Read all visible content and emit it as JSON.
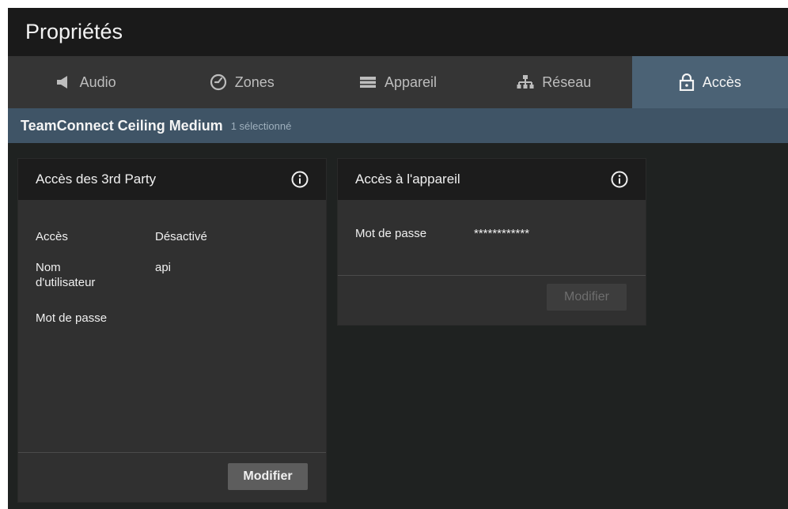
{
  "app": {
    "title": "Propriétés"
  },
  "tabs": [
    {
      "label": "Audio",
      "icon": "speaker-icon",
      "active": false
    },
    {
      "label": "Zones",
      "icon": "zones-icon",
      "active": false
    },
    {
      "label": "Appareil",
      "icon": "device-icon",
      "active": false
    },
    {
      "label": "Réseau",
      "icon": "network-icon",
      "active": false
    },
    {
      "label": "Accès",
      "icon": "lock-icon",
      "active": true
    }
  ],
  "device": {
    "name": "TeamConnect Ceiling Medium",
    "selection": "1 sélectionné"
  },
  "third_party": {
    "title": "Accès des 3rd Party",
    "fields": [
      {
        "label": "Accès",
        "value": "Désactivé"
      },
      {
        "label": "Nom d'utilisateur",
        "value": "api"
      },
      {
        "label": "Mot de passe",
        "value": ""
      }
    ],
    "button": "Modifier"
  },
  "device_access": {
    "title": "Accès à l'appareil",
    "fields": [
      {
        "label": "Mot de passe",
        "value": "************"
      }
    ],
    "button": "Modifier"
  },
  "colors": {
    "active_tab": "#4b6275",
    "device_bar": "#3f5466",
    "background": "#1f2221"
  }
}
